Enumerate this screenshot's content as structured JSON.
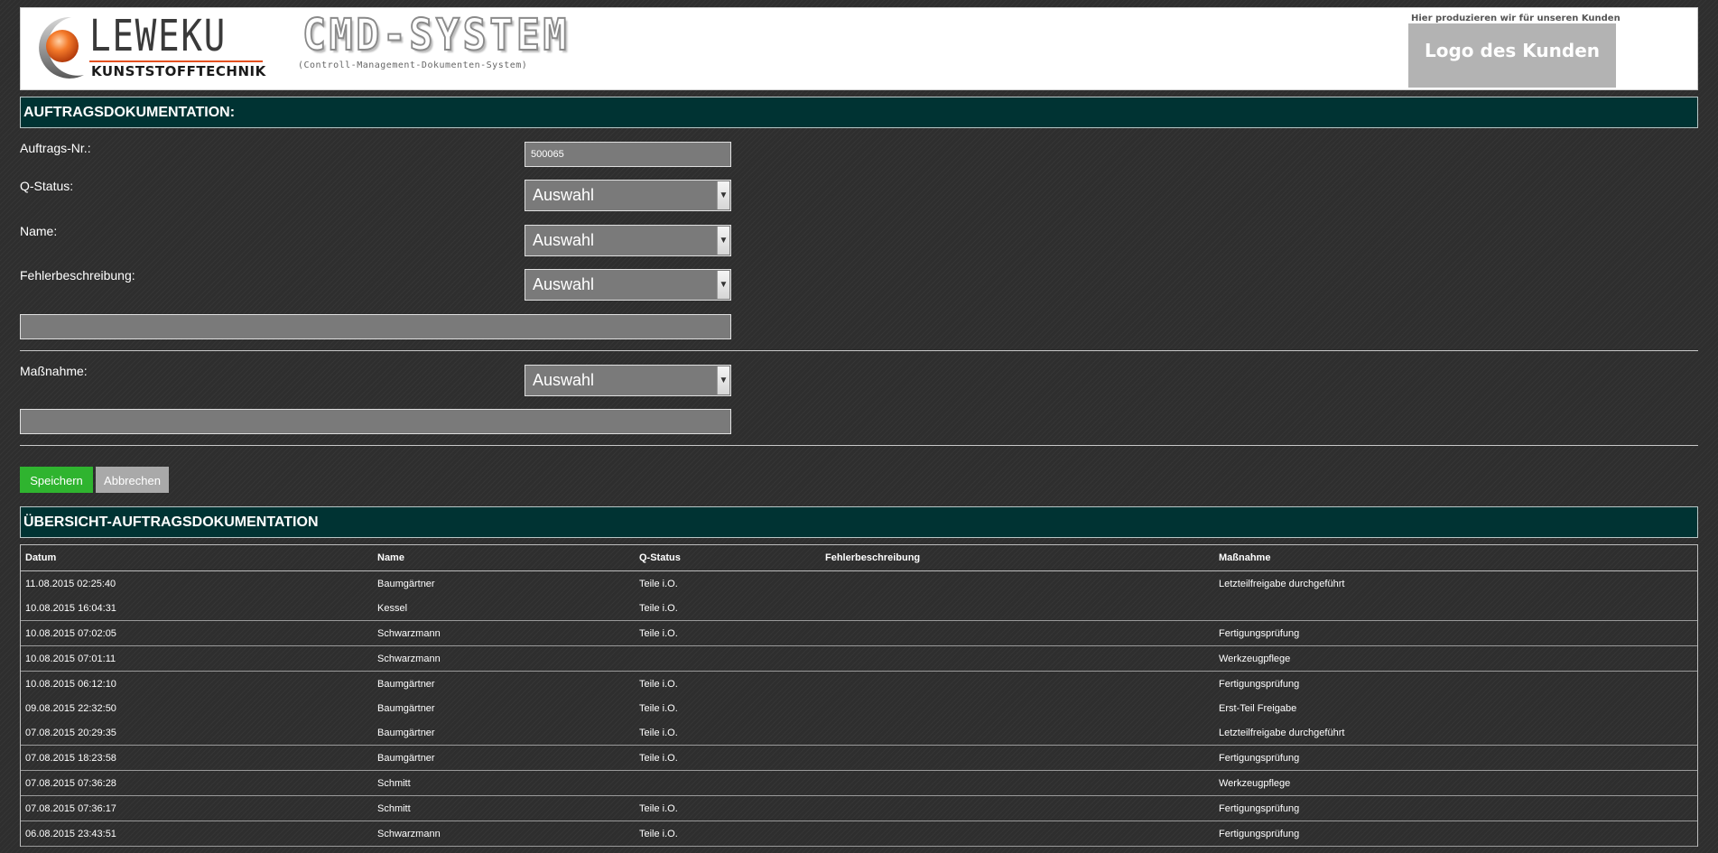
{
  "header": {
    "leweku_name": "LEWEKU",
    "leweku_sub": "KUNSTSTOFFTECHNIK",
    "cmd_title": "CMD-SYSTEM",
    "cmd_subtitle": "(Controll-Management-Dokumenten-System)",
    "customer_note": "Hier produzieren wir für unseren Kunden",
    "customer_logo": "Logo des Kunden"
  },
  "section1": {
    "title": "AUFTRAGSDOKUMENTATION:"
  },
  "form": {
    "order_no_label": "Auftrags-Nr.:",
    "order_no_value": "500065",
    "q_status_label": "Q-Status:",
    "q_status_value": "Auswahl",
    "name_label": "Name:",
    "name_value": "Auswahl",
    "error_label": "Fehlerbeschreibung:",
    "error_value": "Auswahl",
    "error_text": "",
    "measure_label": "Maßnahme:",
    "measure_value": "Auswahl",
    "measure_text": "",
    "save_label": "Speichern",
    "cancel_label": "Abbrechen"
  },
  "section2": {
    "title": "ÜBERSICHT-AUFTRAGSDOKUMENTATION"
  },
  "table": {
    "headers": [
      "Datum",
      "Name",
      "Q-Status",
      "Fehlerbeschreibung",
      "Maßnahme"
    ],
    "rows": [
      [
        "11.08.2015 02:25:40",
        "Baumgärtner",
        "Teile i.O.",
        "",
        "Letzteilfreigabe durchgeführt"
      ],
      [
        "10.08.2015 16:04:31",
        "Kessel",
        "Teile i.O.",
        "",
        ""
      ],
      [
        "10.08.2015 07:02:05",
        "Schwarzmann",
        "Teile i.O.",
        "",
        "Fertigungsprüfung"
      ],
      [
        "10.08.2015 07:01:11",
        "Schwarzmann",
        "",
        "",
        "Werkzeugpflege"
      ],
      [
        "10.08.2015 06:12:10",
        "Baumgärtner",
        "Teile i.O.",
        "",
        "Fertigungsprüfung"
      ],
      [
        "09.08.2015 22:32:50",
        "Baumgärtner",
        "Teile i.O.",
        "",
        "Erst-Teil Freigabe"
      ],
      [
        "07.08.2015 20:29:35",
        "Baumgärtner",
        "Teile i.O.",
        "",
        "Letzteilfreigabe durchgeführt"
      ],
      [
        "07.08.2015 18:23:58",
        "Baumgärtner",
        "Teile i.O.",
        "",
        "Fertigungsprüfung"
      ],
      [
        "07.08.2015 07:36:28",
        "Schmitt",
        "",
        "",
        "Werkzeugpflege"
      ],
      [
        "07.08.2015 07:36:17",
        "Schmitt",
        "Teile i.O.",
        "",
        "Fertigungsprüfung"
      ],
      [
        "06.08.2015 23:43:51",
        "Schwarzmann",
        "Teile i.O.",
        "",
        "Fertigungsprüfung"
      ]
    ]
  },
  "colors": {
    "section_bar": "#003333",
    "save_button": "#2fb42f",
    "cancel_button": "#a9a9a9",
    "accent_orange": "#e3501f"
  }
}
